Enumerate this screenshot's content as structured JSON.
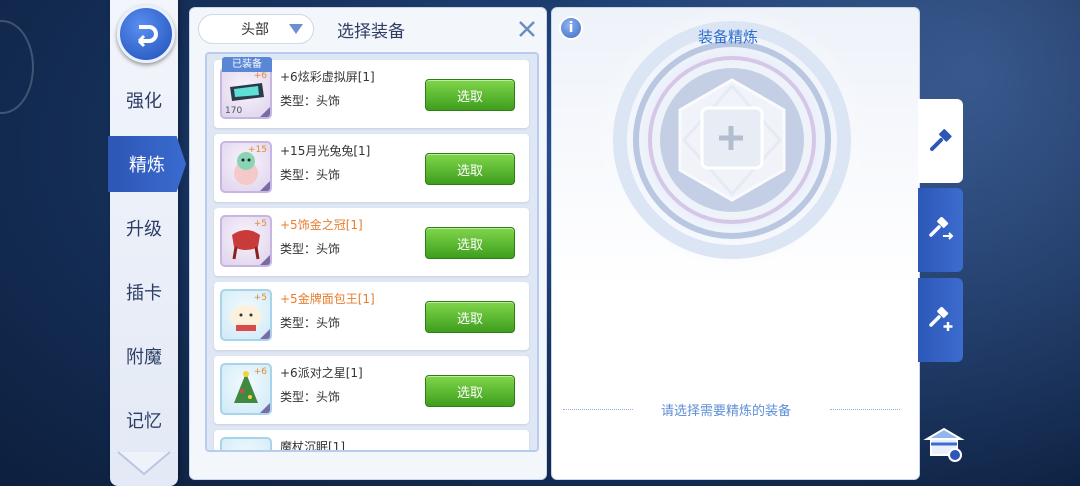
{
  "nav": {
    "items": [
      {
        "label": "强化",
        "active": false
      },
      {
        "label": "精炼",
        "active": true
      },
      {
        "label": "升级",
        "active": false
      },
      {
        "label": "插卡",
        "active": false
      },
      {
        "label": "附魔",
        "active": false
      },
      {
        "label": "记忆",
        "active": false
      }
    ]
  },
  "list_panel": {
    "filter_value": "头部",
    "title": "选择装备",
    "equipped_badge": "已装备",
    "items": [
      {
        "name": "+6炫彩虚拟屏[1]",
        "type": "类型：头饰",
        "refine": "+6",
        "count": "170",
        "button": "选取",
        "highlight": false
      },
      {
        "name": "+15月光兔兔[1]",
        "type": "类型：头饰",
        "refine": "+15",
        "count": "",
        "button": "选取",
        "highlight": false
      },
      {
        "name": "+5饰金之冠[1]",
        "type": "类型：头饰",
        "refine": "+5",
        "count": "",
        "button": "选取",
        "highlight": true
      },
      {
        "name": "+5金牌面包王[1]",
        "type": "类型：头饰",
        "refine": "+5",
        "count": "",
        "button": "选取",
        "highlight": true
      },
      {
        "name": "+6派对之星[1]",
        "type": "类型：头饰",
        "refine": "+6",
        "count": "",
        "button": "选取",
        "highlight": false
      },
      {
        "name": "魔杖沉眠[1]",
        "type": "",
        "refine": "",
        "count": "",
        "button": "",
        "highlight": false
      }
    ]
  },
  "refine_panel": {
    "title": "装备精炼",
    "info_glyph": "i",
    "hint": "请选择需要精炼的装备"
  },
  "colors": {
    "accent": "#2d56b5",
    "button_green": "#4fae25",
    "highlight_text": "#e67e2e"
  },
  "icons": [
    "back-icon",
    "dropdown-arrow-icon",
    "close-icon",
    "info-icon",
    "plus-icon",
    "hammer-icon",
    "hammer-swap-icon",
    "hammer-plus-icon",
    "refine-shop-icon",
    "scroll-down-icon"
  ]
}
